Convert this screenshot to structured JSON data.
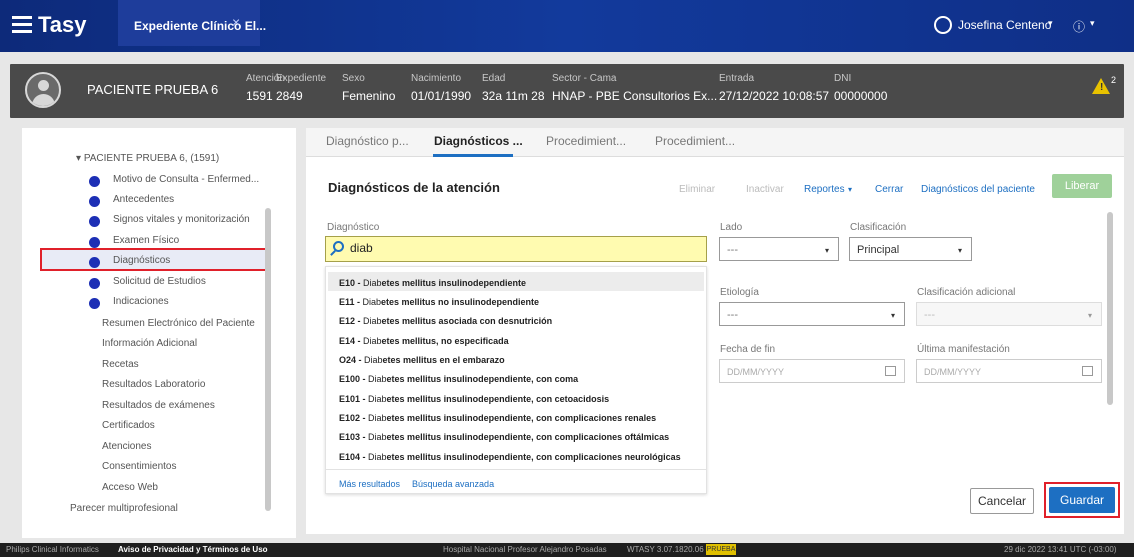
{
  "app": {
    "name": "Tasy",
    "tab_label": "Expediente Clínico El...",
    "tab_close": "×",
    "user_name": "Josefina Centeno",
    "user_caret": "▾",
    "info_symbol": "ⓘ",
    "info_caret": "▾"
  },
  "patient": {
    "name": "PACIENTE PRUEBA 6",
    "fields": [
      {
        "label": "Atención",
        "value": "1591"
      },
      {
        "label": "Expediente",
        "value": "2849"
      },
      {
        "label": "Sexo",
        "value": "Femenino"
      },
      {
        "label": "Nacimiento",
        "value": "01/01/1990"
      },
      {
        "label": "Edad",
        "value": "32a 11m 28"
      },
      {
        "label": "Sector - Cama",
        "value": "HNAP - PBE Consultorios Ex..."
      },
      {
        "label": "Entrada",
        "value": "27/12/2022 10:08:57"
      },
      {
        "label": "DNI",
        "value": "00000000"
      }
    ],
    "warning_mark": "!",
    "warning_count": "2",
    "warning_color": "#e8c200"
  },
  "tree": {
    "root": "PACIENTE PRUEBA 6, (1591)",
    "items": [
      "Motivo de Consulta - Enfermed...",
      "Antecedentes",
      "Signos vitales y monitorización",
      "Examen Físico",
      "Diagnósticos",
      "Solicitud de Estudios",
      "Indicaciones"
    ],
    "subitems": [
      "Resumen Electrónico del Paciente",
      "Información Adicional",
      "Recetas",
      "Resultados Laboratorio",
      "Resultados de exámenes",
      "Certificados",
      "Atenciones",
      "Consentimientos",
      "Acceso Web"
    ],
    "footer_item": "Parecer multiprofesional"
  },
  "tabs": [
    "Diagnóstico p...",
    "Diagnósticos ...",
    "Procedimient...",
    "Procedimient..."
  ],
  "section": {
    "title": "Diagnósticos de la atención",
    "actions": {
      "eliminar": "Eliminar",
      "inactivar": "Inactivar",
      "reportes": "Reportes",
      "reportes_caret": "▾",
      "cerrar": "Cerrar",
      "diag_paciente": "Diagnósticos del paciente"
    },
    "liberar": "Liberar"
  },
  "form": {
    "diagnostico_label": "Diagnóstico",
    "search_value": "diab",
    "lado_label": "Lado",
    "lado_value": "---",
    "clasificacion_label": "Clasificación",
    "clasificacion_value": "Principal",
    "etiologia_label": "Etiología",
    "etiologia_value": "---",
    "clas_adicional_label": "Clasificación adicional",
    "clas_adicional_value": "---",
    "fecha_fin_label": "Fecha de fin",
    "fecha_fin_placeholder": "DD/MM/YYYY",
    "ultima_label": "Última manifestación",
    "ultima_placeholder": "DD/MM/YYYY",
    "caret": "▾"
  },
  "results": [
    "E10 - Diabetes mellitus insulinodependiente",
    "E11 - Diabetes mellitus no insulinodependiente",
    "E12 - Diabetes mellitus asociada con desnutrición",
    "E14 - Diabetes mellitus, no especificada",
    "O24 - Diabetes mellitus en el embarazo",
    "E100 - Diabetes mellitus insulinodependiente, con coma",
    "E101 - Diabetes mellitus insulinodependiente, con cetoacidosis",
    "E102 - Diabetes mellitus insulinodependiente, con complicaciones renales",
    "E103 - Diabetes mellitus insulinodependiente, con complicaciones oftálmicas",
    "E104 - Diabetes mellitus insulinodependiente, con complicaciones neurológicas"
  ],
  "results_links": {
    "more": "Más resultados",
    "advanced": "Búsqueda avanzada"
  },
  "buttons": {
    "cancel": "Cancelar",
    "save": "Guardar"
  },
  "footer": {
    "left": "Philips Clinical Informatics",
    "privacy": "Aviso de Privacidad y Términos de Uso",
    "hospital": "Hospital Nacional Profesor Alejandro Posadas",
    "version": "WTASY 3.07.1820.06",
    "badge": "PRUEBA",
    "datetime": "29 dic 2022  13:41  UTC (-03:00)"
  },
  "colors": {
    "topbar": "#0d2a7a",
    "accent": "#1d6fc2",
    "highlight": "#e0202a",
    "search_bg": "#fffbb0"
  }
}
